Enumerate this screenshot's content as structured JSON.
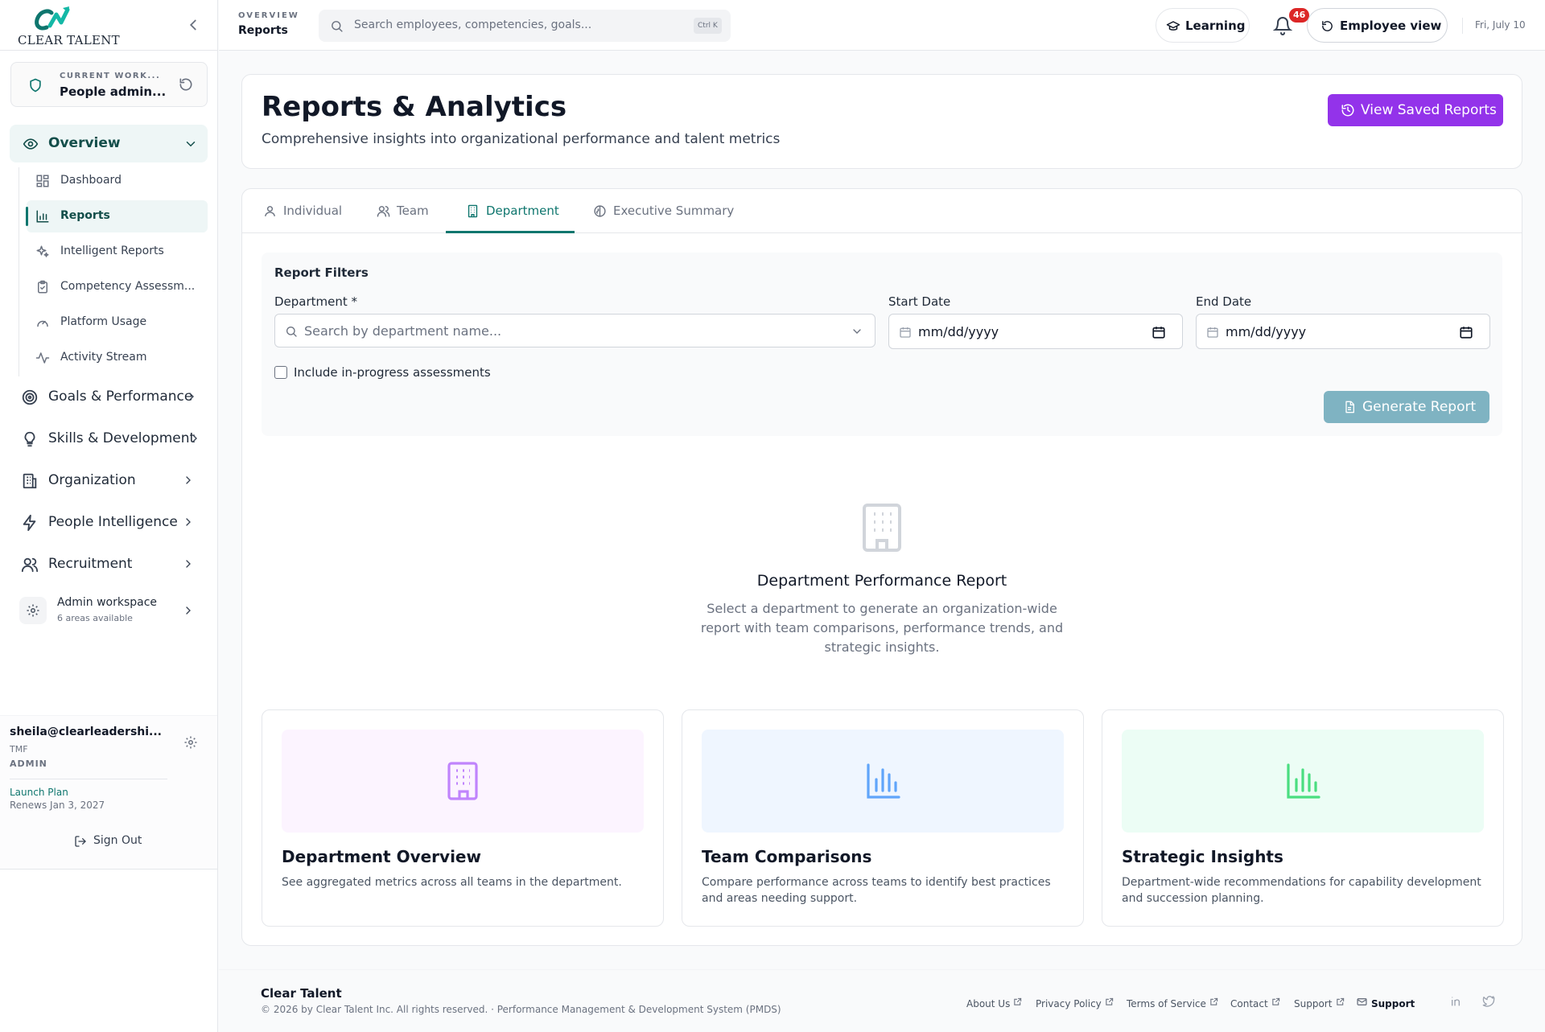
{
  "app": {
    "logo_text": "CLEAR TALENT"
  },
  "sidebar": {
    "workspace": {
      "label": "CURRENT WORK...",
      "value": "People admin..."
    },
    "overview_group": {
      "label": "Overview"
    },
    "sub_items": [
      {
        "label": "Dashboard",
        "icon": "dashboard-grid-icon"
      },
      {
        "label": "Reports",
        "icon": "bar-chart-icon",
        "active": true
      },
      {
        "label": "Intelligent Reports",
        "icon": "sparkles-icon"
      },
      {
        "label": "Competency Assessm...",
        "icon": "clipboard-check-icon"
      },
      {
        "label": "Platform Usage",
        "icon": "gauge-icon"
      },
      {
        "label": "Activity Stream",
        "icon": "activity-icon"
      }
    ],
    "nav_items": [
      {
        "label": "Goals & Performance",
        "icon": "target-icon"
      },
      {
        "label": "Skills & Development",
        "icon": "lightbulb-icon"
      },
      {
        "label": "Organization",
        "icon": "building-icon"
      },
      {
        "label": "People Intelligence",
        "icon": "zap-icon"
      },
      {
        "label": "Recruitment",
        "icon": "users-icon"
      }
    ],
    "admin_workspace": {
      "label": "Admin workspace",
      "sub": "6 areas available"
    },
    "user": {
      "email": "sheila@clearleadershi...",
      "org": "TMF",
      "role": "ADMIN",
      "plan": "Launch Plan",
      "renews": "Renews Jan 3, 2027",
      "sign_out": "Sign Out"
    }
  },
  "topbar": {
    "breadcrumb_section": "OVERVIEW",
    "breadcrumb_page": "Reports",
    "search_placeholder": "Search employees, competencies, goals...",
    "search_shortcut": "Ctrl K",
    "learning_label": "Learning",
    "notification_count": "46",
    "employee_view_label": "Employee view",
    "date": "Fri, July 10"
  },
  "header": {
    "title": "Reports & Analytics",
    "subtitle": "Comprehensive insights into organizational performance and talent metrics",
    "saved_reports_label": "View Saved Reports"
  },
  "tabs": [
    {
      "label": "Individual",
      "icon": "user-icon"
    },
    {
      "label": "Team",
      "icon": "users-icon"
    },
    {
      "label": "Department",
      "icon": "building-icon",
      "active": true
    },
    {
      "label": "Executive Summary",
      "icon": "brain-icon"
    }
  ],
  "filters": {
    "title": "Report Filters",
    "department_label": "Department *",
    "department_placeholder": "Search by department name...",
    "start_label": "Start Date",
    "start_value": "mm/dd/yyyy",
    "end_label": "End Date",
    "end_value": "mm/dd/yyyy",
    "include_in_progress": "Include in-progress assessments",
    "include_checked": false,
    "generate_label": "Generate Report"
  },
  "empty_state": {
    "title": "Department Performance Report",
    "description": "Select a department to generate an organization-wide report with team comparisons, performance trends, and strategic insights."
  },
  "features": [
    {
      "title": "Department Overview",
      "description": "See aggregated metrics across all teams in the department.",
      "icon": "building-icon",
      "bg": "#fcf4ff",
      "color": "#c084fc"
    },
    {
      "title": "Team Comparisons",
      "description": "Compare performance across teams to identify best practices and areas needing support.",
      "icon": "bar-chart-icon",
      "bg": "#eff6ff",
      "color": "#60a5fa"
    },
    {
      "title": "Strategic Insights",
      "description": "Department-wide recommendations for capability development and succession planning.",
      "icon": "bar-chart-icon",
      "bg": "#ecfdf5",
      "color": "#4ade80"
    }
  ],
  "footer": {
    "brand": "Clear Talent",
    "copyright": "© 2026 by Clear Talent Inc. All rights reserved. · Performance Management & Development System (PMDS)",
    "links": [
      "About Us",
      "Privacy Policy",
      "Terms of Service",
      "Contact",
      "Support"
    ],
    "support_label": "Support"
  },
  "colors": {
    "accent": "#0f766e",
    "primary_button": "#9333ea",
    "generate_disabled": "#7fb3c2",
    "badge": "#dc2626"
  }
}
